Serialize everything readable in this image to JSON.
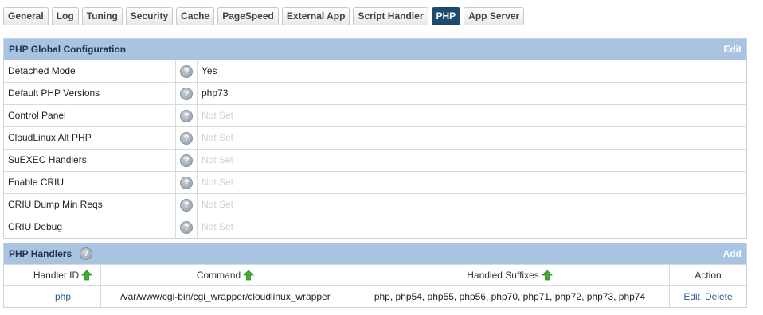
{
  "tabs": [
    {
      "label": "General",
      "active": false
    },
    {
      "label": "Log",
      "active": false
    },
    {
      "label": "Tuning",
      "active": false
    },
    {
      "label": "Security",
      "active": false
    },
    {
      "label": "Cache",
      "active": false
    },
    {
      "label": "PageSpeed",
      "active": false
    },
    {
      "label": "External App",
      "active": false
    },
    {
      "label": "Script Handler",
      "active": false
    },
    {
      "label": "PHP",
      "active": true
    },
    {
      "label": "App Server",
      "active": false
    }
  ],
  "global_config": {
    "title": "PHP Global Configuration",
    "action": "Edit",
    "rows": [
      {
        "label": "Detached Mode",
        "value": "Yes",
        "empty": false
      },
      {
        "label": "Default PHP Versions",
        "value": "php73",
        "empty": false
      },
      {
        "label": "Control Panel",
        "value": "Not Set",
        "empty": true
      },
      {
        "label": "CloudLinux Alt PHP",
        "value": "Not Set",
        "empty": true
      },
      {
        "label": "SuEXEC Handlers",
        "value": "Not Set",
        "empty": true
      },
      {
        "label": "Enable CRIU",
        "value": "Not Set",
        "empty": true
      },
      {
        "label": "CRIU Dump Min Reqs",
        "value": "Not Set",
        "empty": true
      },
      {
        "label": "CRIU Debug",
        "value": "Not Set",
        "empty": true
      }
    ]
  },
  "handlers": {
    "title": "PHP Handlers",
    "action": "Add",
    "columns": {
      "handler_id": "Handler ID",
      "command": "Command",
      "suffixes": "Handled Suffixes",
      "action": "Action"
    },
    "rows": [
      {
        "handler_id": "php",
        "command": "/var/www/cgi-bin/cgi_wrapper/cloudlinux_wrapper",
        "suffixes": "php, php54, php55, php56, php70, php71, php72, php73, php74",
        "edit": "Edit",
        "delete": "Delete"
      }
    ]
  },
  "icons": {
    "help": "help-icon",
    "sort": "sort-ascending-icon"
  },
  "colors": {
    "header_bg": "#a9c4e0",
    "active_tab": "#1f4a6b",
    "link": "#2b5b91",
    "sort_arrow": "#3fae2a"
  }
}
